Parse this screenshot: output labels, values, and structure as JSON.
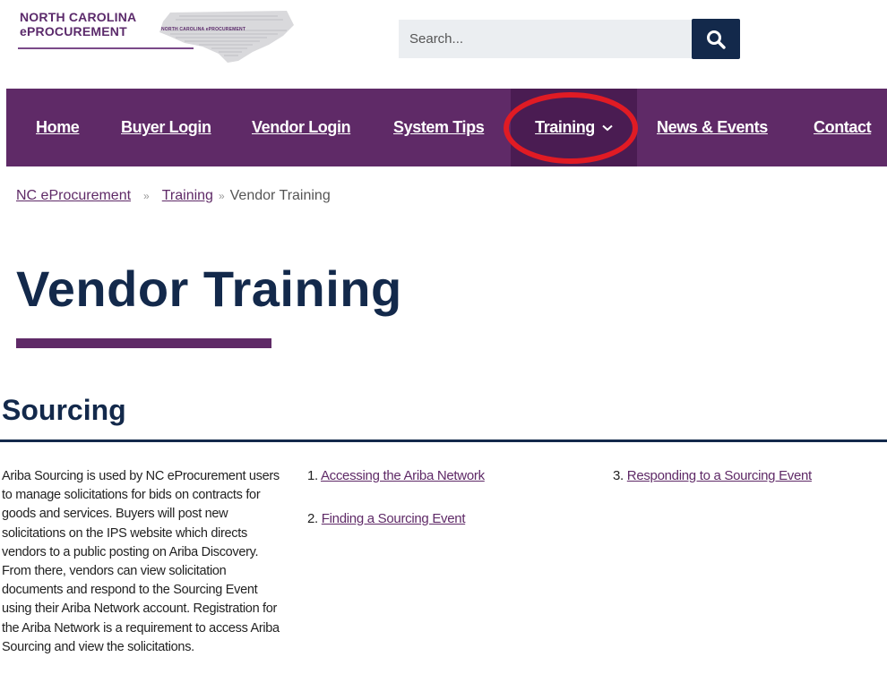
{
  "logo": {
    "line1": "NORTH CAROLINA",
    "line2": "ePROCUREMENT",
    "tagline": "NORTH CAROLINA ePROCUREMENT"
  },
  "search": {
    "placeholder": "Search...",
    "value": "",
    "button_icon": "search-icon"
  },
  "nav": {
    "items": [
      {
        "label": "Home"
      },
      {
        "label": "Buyer Login"
      },
      {
        "label": "Vendor Login"
      },
      {
        "label": "System Tips"
      },
      {
        "label": "Training",
        "icon": "chevron-down-icon",
        "active": true
      },
      {
        "label": "News & Events"
      },
      {
        "label": "Contact"
      }
    ]
  },
  "breadcrumb": {
    "items": [
      {
        "label": "NC eProcurement",
        "link": true
      },
      {
        "label": "Training",
        "link": true
      },
      {
        "label": "Vendor Training",
        "link": false
      }
    ],
    "separator": "»"
  },
  "page": {
    "title": "Vendor Training"
  },
  "section": {
    "title": "Sourcing",
    "description": "Ariba Sourcing is used by NC eProcurement users to manage solicitations for bids on contracts for goods and services. Buyers will post new solicitations on the IPS website which directs vendors to a public posting on Ariba Discovery. From there, vendors can view solicitation documents and respond to the Sourcing Event using their Ariba Network account. Registration for the Ariba Network is a requirement to access Ariba Sourcing and view the solicitations.",
    "links": [
      {
        "num": "1.",
        "label": "Accessing the Ariba Network"
      },
      {
        "num": "2.",
        "label": "Finding a Sourcing Event"
      },
      {
        "num": "3.",
        "label": "Responding to a Sourcing Event"
      }
    ]
  },
  "colors": {
    "brand_purple": "#5f2a67",
    "active_nav": "#4a1c52",
    "navy": "#13294b",
    "highlight_red": "#e01b24"
  }
}
